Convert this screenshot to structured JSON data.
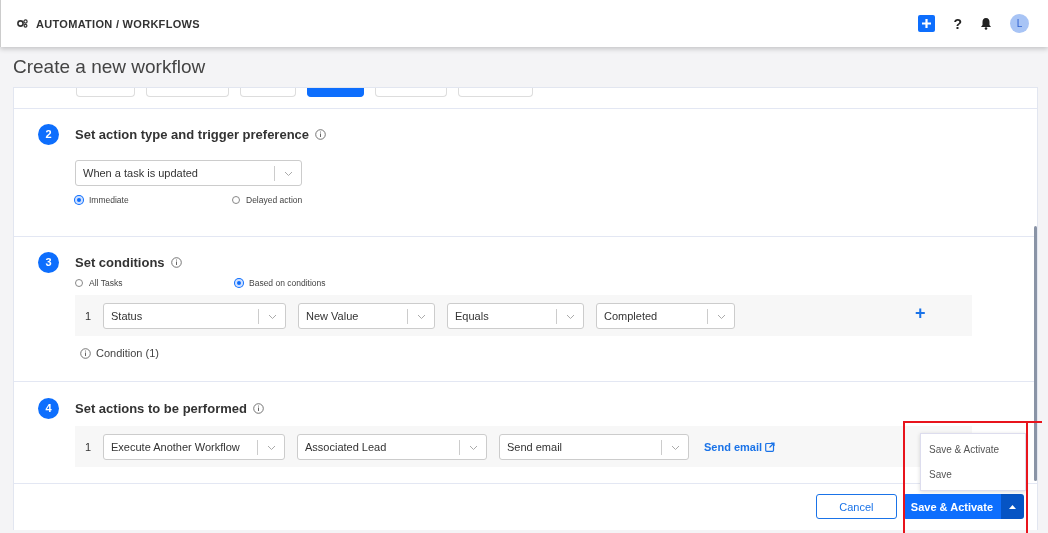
{
  "header": {
    "breadcrumb": "AUTOMATION / WORKFLOWS",
    "avatar_initial": "L",
    "help": "?"
  },
  "page_title": "Create a new workflow",
  "step1_chips": [
    {
      "selected": false
    },
    {
      "selected": false
    },
    {
      "selected": false
    },
    {
      "selected": true
    },
    {
      "selected": false
    },
    {
      "selected": false
    }
  ],
  "sections": [
    {
      "number": "2",
      "title": "Set action type and trigger preference",
      "kind": "trigger",
      "select": "When a task is updated",
      "radios": [
        {
          "label": "Immediate",
          "selected": true
        },
        {
          "label": "Delayed action",
          "selected": false
        }
      ]
    },
    {
      "number": "3",
      "title": "Set conditions",
      "kind": "conditions",
      "radios": [
        {
          "label": "All Tasks",
          "selected": false
        },
        {
          "label": "Based on conditions",
          "selected": true
        }
      ],
      "rows": [
        {
          "index": "1",
          "selects": [
            "Status",
            "New Value",
            "Equals",
            "Completed"
          ],
          "add": "+"
        }
      ],
      "note": "Condition (1)"
    },
    {
      "number": "4",
      "title": "Set actions to be performed",
      "kind": "actions",
      "rows": [
        {
          "index": "1",
          "selects": [
            "Execute Another Workflow",
            "Associated Lead",
            "Send email"
          ],
          "link": "Send email"
        }
      ]
    }
  ],
  "footer": {
    "cancel": "Cancel",
    "primary": "Save & Activate"
  },
  "dropdown_menu": [
    "Save & Activate",
    "Save"
  ]
}
